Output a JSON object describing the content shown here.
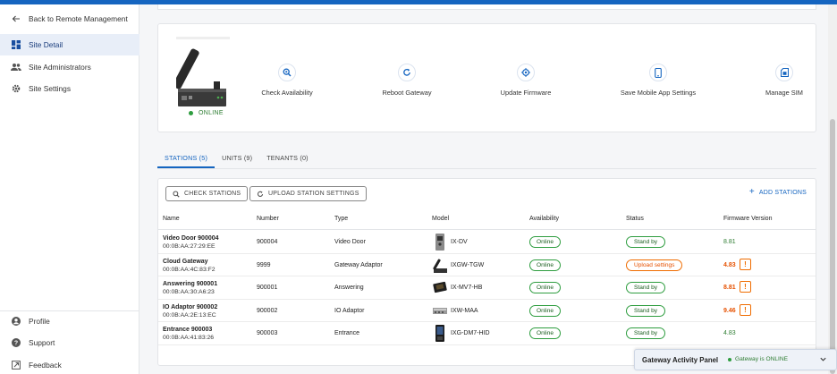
{
  "sidebar": {
    "back_label": "Back to Remote Management",
    "items": [
      {
        "label": "Site Detail",
        "icon": "dashboard-icon",
        "active": true
      },
      {
        "label": "Site Administrators",
        "icon": "people-icon",
        "active": false
      },
      {
        "label": "Site Settings",
        "icon": "gear-icon",
        "active": false
      }
    ],
    "footer": [
      {
        "label": "Profile",
        "icon": "account-icon"
      },
      {
        "label": "Support",
        "icon": "help-icon"
      },
      {
        "label": "Feedback",
        "icon": "external-link-icon"
      }
    ]
  },
  "gateway": {
    "status": "ONLINE",
    "actions": [
      {
        "label": "Check Availability",
        "icon": "search-icon"
      },
      {
        "label": "Reboot Gateway",
        "icon": "refresh-icon"
      },
      {
        "label": "Update Firmware",
        "icon": "target-icon"
      },
      {
        "label": "Save Mobile App Settings",
        "icon": "phone-icon"
      },
      {
        "label": "Manage SIM",
        "icon": "sim-icon"
      }
    ]
  },
  "tabs": [
    {
      "label": "STATIONS (5)",
      "active": true
    },
    {
      "label": "UNITS (9)",
      "active": false
    },
    {
      "label": "TENANTS (0)",
      "active": false
    }
  ],
  "toolbar": {
    "check_label": "CHECK STATIONS",
    "upload_label": "UPLOAD STATION SETTINGS",
    "add_label": "ADD STATIONS"
  },
  "table": {
    "columns": [
      "Name",
      "Number",
      "Type",
      "Model",
      "Availability",
      "Status",
      "Firmware Version"
    ],
    "rows": [
      {
        "name": "Video Door 900004",
        "mac": "00:0B:AA:27:29:EE",
        "number": "900004",
        "type": "Video Door",
        "model": "IX-DV",
        "availability": "Online",
        "status": "Stand by",
        "firmware": "8.81",
        "fw_warning": false
      },
      {
        "name": "Cloud Gateway",
        "mac": "00:0B:AA:4C:83:F2",
        "number": "9999",
        "type": "Gateway Adaptor",
        "model": "IXGW-TGW",
        "availability": "Online",
        "status": "Upload settings",
        "firmware": "4.83",
        "fw_warning": true
      },
      {
        "name": "Answering 900001",
        "mac": "00:0B:AA:30:A6:23",
        "number": "900001",
        "type": "Answering",
        "model": "IX-MV7-HB",
        "availability": "Online",
        "status": "Stand by",
        "firmware": "8.81",
        "fw_warning": true
      },
      {
        "name": "IO Adaptor 900002",
        "mac": "00:0B:AA:2E:13:EC",
        "number": "900002",
        "type": "IO Adaptor",
        "model": "IXW-MAA",
        "availability": "Online",
        "status": "Stand by",
        "firmware": "9.46",
        "fw_warning": true
      },
      {
        "name": "Entrance 900003",
        "mac": "00:0B:AA:41:83:26",
        "number": "900003",
        "type": "Entrance",
        "model": "IXG-DM7-HID",
        "availability": "Online",
        "status": "Stand by",
        "firmware": "4.83",
        "fw_warning": false
      }
    ],
    "warning_glyph": "!"
  },
  "activity_panel": {
    "title": "Gateway Activity Panel",
    "gateway_status": "Gateway is ONLINE"
  },
  "colors": {
    "accent": "#1565c0",
    "online": "#2e9d3f",
    "warning": "#ef6c00"
  }
}
